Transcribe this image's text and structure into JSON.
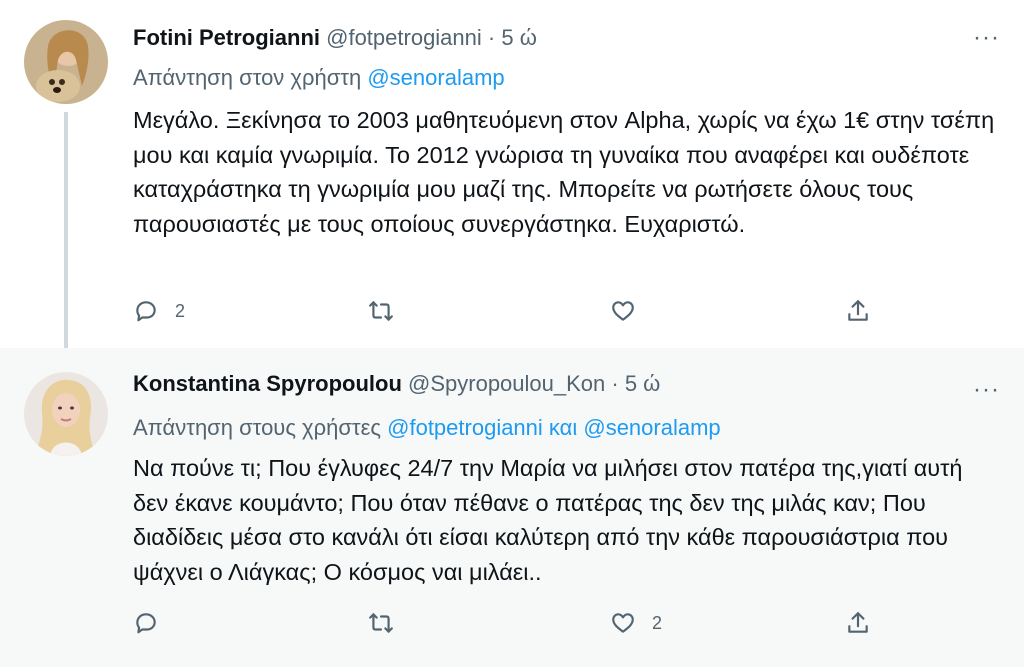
{
  "tweets": [
    {
      "display_name": "Fotini Petrogianni",
      "handle": "@fotpetrogianni",
      "separator": " · ",
      "time": "5 ώ",
      "more_label": "···",
      "replying_prefix": "Απάντηση στον χρήστη ",
      "replying_users": "@senoralamp",
      "body": "Μεγάλο. Ξεκίνησα το 2003 μαθητευόμενη στον Alpha, χωρίς να έχω 1€ στην τσέπη μου και καμία γνωριμία. Το 2012 γνώρισα τη γυναίκα που αναφέρει και ουδέποτε καταχράστηκα τη γνωριμία μου μαζί της. Μπορείτε να ρωτήσετε όλους τους παρουσιαστές με τους οποίους συνεργάστηκα. Ευχαριστώ.",
      "reply_count": "2",
      "retweet_count": "",
      "like_count": ""
    },
    {
      "display_name": "Konstantina Spyropoulou",
      "handle": "@Spyropoulou_Kon",
      "separator": " · ",
      "time": "5 ώ",
      "more_label": "···",
      "replying_prefix": "Απάντηση στους χρήστες ",
      "replying_users": "@fotpetrogianni και @senoralamp",
      "body": "Να πούνε τι; Που έγλυφες 24/7 την Μαρία να μιλήσει στον πατέρα της,γιατί αυτή δεν έκανε κουμάντο; Που όταν πέθανε ο πατέρας της δεν της μιλάς καν; Που διαδίδεις μέσα στο κανάλι ότι είσαι καλύτερη από την κάθε παρουσιάστρια που ψάχνει ο Λιάγκας; Ο κόσμος ναι μιλάει..",
      "reply_count": "",
      "retweet_count": "",
      "like_count": "2"
    }
  ],
  "icons": {
    "reply": "comment-bubble-icon",
    "retweet": "retweet-icon",
    "like": "heart-icon",
    "share": "share-upload-icon",
    "more": "more-dots-icon"
  },
  "colors": {
    "text": "#0f1419",
    "secondary": "#536471",
    "link": "#1d9bf0",
    "thread_line": "#cfd9de",
    "second_bg": "#f7f9f9"
  }
}
